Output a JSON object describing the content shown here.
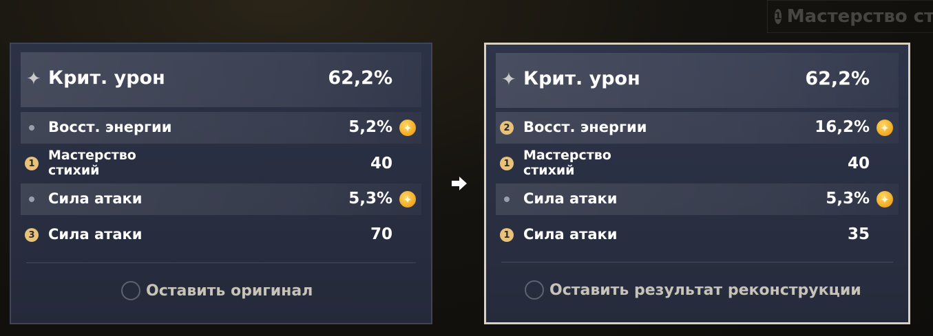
{
  "background_hint": {
    "number": "1",
    "label": "Мастерство сти"
  },
  "left_panel": {
    "main": {
      "label": "Крит. урон",
      "value": "62,2%"
    },
    "substats": [
      {
        "marker": "bullet",
        "label": "Восст. энергии",
        "value": "5,2%",
        "boosted": true
      },
      {
        "marker": "1",
        "label": "Мастерство стихий",
        "value": "40",
        "boosted": false
      },
      {
        "marker": "bullet",
        "label": "Сила атаки",
        "value": "5,3%",
        "boosted": true
      },
      {
        "marker": "3",
        "label": "Сила атаки",
        "value": "70",
        "boosted": false
      }
    ],
    "option_label": "Оставить оригинал"
  },
  "right_panel": {
    "main": {
      "label": "Крит. урон",
      "value": "62,2%"
    },
    "substats": [
      {
        "marker": "2",
        "label": "Восст. энергии",
        "value": "16,2%",
        "boosted": true
      },
      {
        "marker": "1",
        "label": "Мастерство стихий",
        "value": "40",
        "boosted": false
      },
      {
        "marker": "bullet",
        "label": "Сила атаки",
        "value": "5,3%",
        "boosted": true
      },
      {
        "marker": "1",
        "label": "Сила атаки",
        "value": "35",
        "boosted": false
      }
    ],
    "option_label": "Оставить результат реконструкции"
  },
  "colors": {
    "selected_border": "#d9d2c0",
    "boost_icon": "#f0a81f",
    "number_badge": "#e8c27a"
  },
  "icons": {
    "main_stat": "four-point-star-icon",
    "boost": "boost-star-icon",
    "arrow": "arrow-right-icon"
  }
}
